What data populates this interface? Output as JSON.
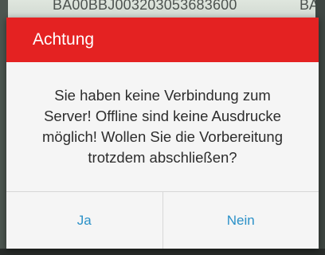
{
  "background": {
    "id_text": "BA00BBJ003203053683600",
    "side_text": "BA"
  },
  "dialog": {
    "title": "Achtung",
    "message": "Sie haben keine Verbindung zum\nServer! Offline sind keine Ausdrucke\nmöglich! Wollen Sie die Vorbereitung\ntrotzdem abschließen?",
    "buttons": {
      "yes_label": "Ja",
      "no_label": "Nein"
    }
  },
  "colors": {
    "header": "#e42222",
    "button_text": "#2b91c8",
    "dialog_background": "#f5f5f5"
  }
}
